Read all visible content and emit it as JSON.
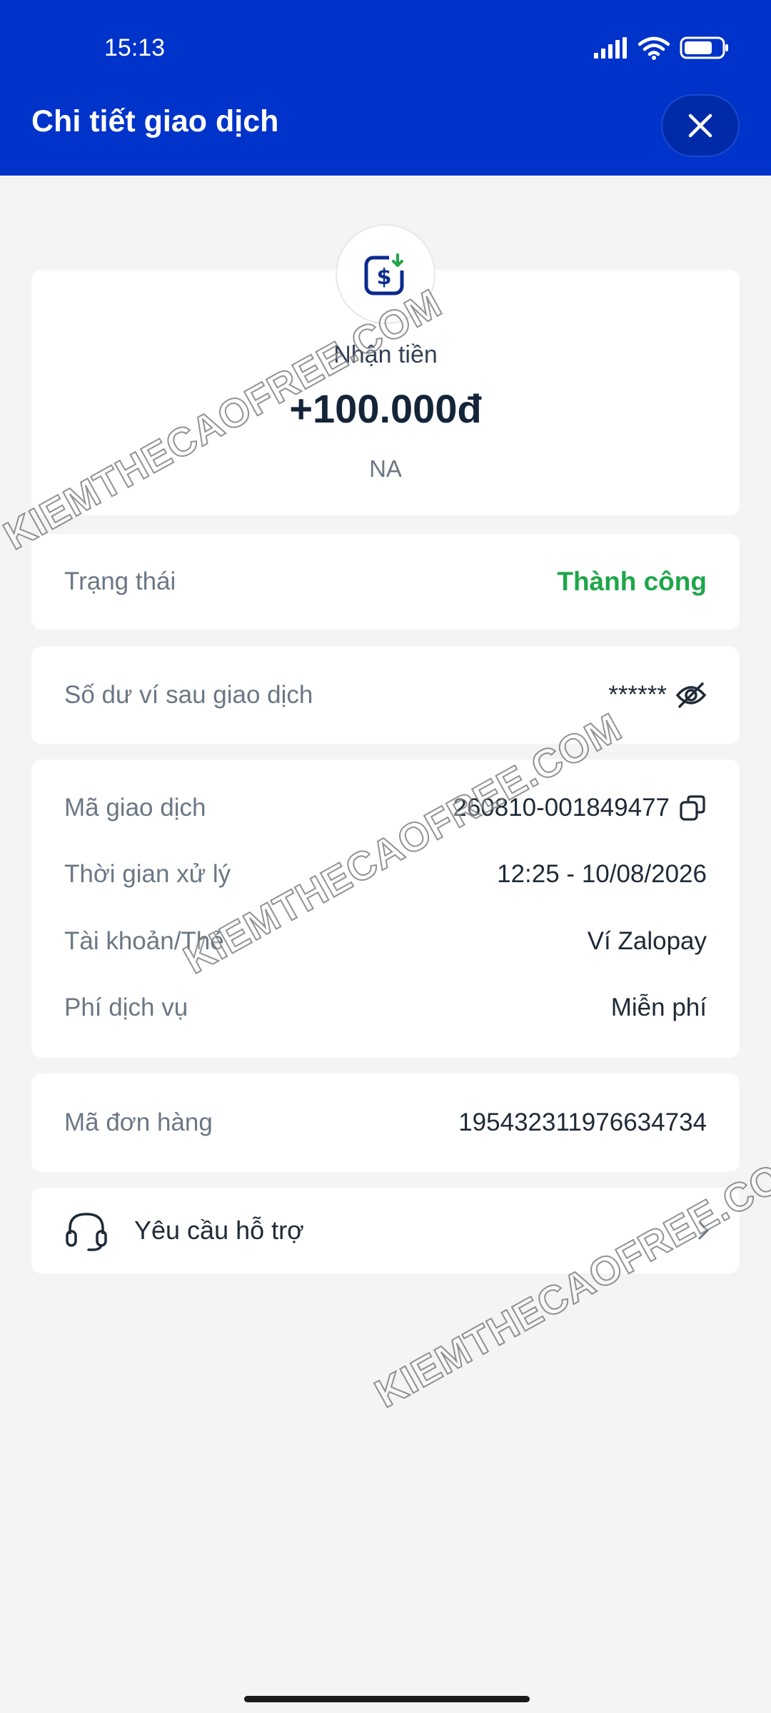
{
  "status_bar": {
    "time": "15:13"
  },
  "header": {
    "title": "Chi tiết giao dịch"
  },
  "summary": {
    "type_label": "Nhận tiền",
    "amount": "+100.000đ",
    "counterparty": "NA"
  },
  "status_row": {
    "label": "Trạng thái",
    "value": "Thành công"
  },
  "balance_row": {
    "label": "Số dư ví sau giao dịch",
    "value": "******"
  },
  "details": [
    {
      "label": "Mã giao dịch",
      "value": "260810-001849477"
    },
    {
      "label": "Thời gian xử lý",
      "value": "12:25 - 10/08/2026"
    },
    {
      "label": "Tài khoản/Thẻ",
      "value": "Ví Zalopay"
    },
    {
      "label": "Phí dịch vụ",
      "value": "Miễn phí"
    }
  ],
  "order_row": {
    "label": "Mã đơn hàng",
    "value": "195432311976634734"
  },
  "support": {
    "label": "Yêu cầu hỗ trợ"
  },
  "watermark": {
    "text": "KIEMTHECAOFREE.COM"
  },
  "colors": {
    "header": "#0033c9",
    "success": "#1fa64a",
    "background": "#f4f4f5"
  },
  "icons": [
    "signal-icon",
    "wifi-icon",
    "battery-icon",
    "close-icon",
    "receive-money-icon",
    "eye-off-icon",
    "copy-icon",
    "headset-icon",
    "chevron-right-icon"
  ]
}
